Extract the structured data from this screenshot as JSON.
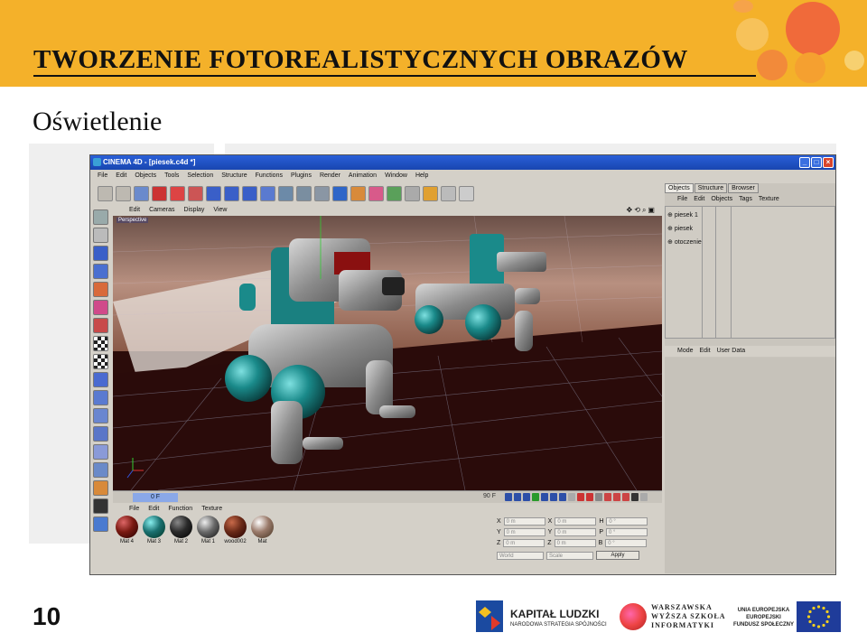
{
  "slide": {
    "title": "TWORZENIE FOTOREALISTYCZNYCH OBRAZÓW",
    "subtitle": "Oświetlenie",
    "page_number": "10"
  },
  "app": {
    "window_title": "CINEMA 4D - [piesek.c4d *]",
    "menu": [
      "File",
      "Edit",
      "Objects",
      "Tools",
      "Selection",
      "Structure",
      "Functions",
      "Plugins",
      "Render",
      "Animation",
      "Window",
      "Help"
    ],
    "viewport": {
      "menu": [
        "Edit",
        "Cameras",
        "Display",
        "View"
      ],
      "label": "Perspective"
    },
    "timeline": {
      "current_frame": "0 F",
      "end_frame": "90 F"
    },
    "material_manager": {
      "menu": [
        "File",
        "Edit",
        "Function",
        "Texture"
      ],
      "materials": [
        {
          "name": "Mat 4",
          "color": "#7a1a12"
        },
        {
          "name": "Mat 3",
          "color": "#1a7070"
        },
        {
          "name": "Mat 2",
          "color": "#2a2a2a"
        },
        {
          "name": "Mat 1",
          "color": "#6a6a6a"
        },
        {
          "name": "wood002",
          "color": "#6a2a18"
        },
        {
          "name": "Mat",
          "color": "#9a7a6a"
        }
      ]
    },
    "coordinates": {
      "rows": [
        {
          "a": "X",
          "av": "0 m",
          "b": "X",
          "bv": "0 m",
          "c": "H",
          "cv": "0 °"
        },
        {
          "a": "Y",
          "av": "0 m",
          "b": "Y",
          "bv": "0 m",
          "c": "P",
          "cv": "0 °"
        },
        {
          "a": "Z",
          "av": "0 m",
          "b": "Z",
          "bv": "0 m",
          "c": "B",
          "cv": "0 °"
        }
      ],
      "mode1": "World",
      "mode2": "Scale",
      "apply": "Apply"
    },
    "object_manager": {
      "tabs": [
        "Objects",
        "Structure",
        "Browser"
      ],
      "menu": [
        "File",
        "Edit",
        "Objects",
        "Tags",
        "Texture"
      ],
      "objects": [
        "piesek 1",
        "piesek",
        "otoczenie"
      ]
    },
    "attribute_manager": {
      "menu": [
        "Mode",
        "Edit",
        "User Data"
      ]
    }
  },
  "footer": {
    "kapital_title": "KAPITAŁ LUDZKI",
    "kapital_sub": "NARODOWA STRATEGIA SPÓJNOŚCI",
    "wsi": [
      "WARSZAWSKA",
      "WYŻSZA SZKOŁA",
      "INFORMATYKI"
    ],
    "ue": [
      "UNIA EUROPEJSKA",
      "EUROPEJSKI",
      "FUNDUSZ SPOŁECZNY"
    ]
  }
}
